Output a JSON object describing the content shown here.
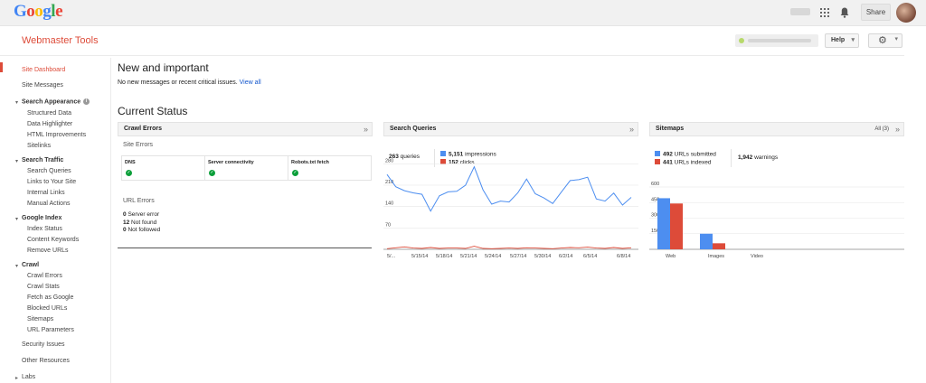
{
  "header": {
    "logo_letters": [
      {
        "ch": "G",
        "color": "#4285f4"
      },
      {
        "ch": "o",
        "color": "#ea4335"
      },
      {
        "ch": "o",
        "color": "#fbbc05"
      },
      {
        "ch": "g",
        "color": "#4285f4"
      },
      {
        "ch": "l",
        "color": "#34a853"
      },
      {
        "ch": "e",
        "color": "#ea4335"
      }
    ],
    "share_label": "Share"
  },
  "product": {
    "title": "Webmaster Tools",
    "help_label": "Help"
  },
  "sidebar": {
    "items": [
      {
        "label": "Site Dashboard",
        "kind": "item",
        "active": true
      },
      {
        "label": "Site Messages",
        "kind": "item"
      },
      {
        "label": "Search Appearance",
        "kind": "section",
        "info": true
      },
      {
        "label": "Structured Data",
        "kind": "sub"
      },
      {
        "label": "Data Highlighter",
        "kind": "sub"
      },
      {
        "label": "HTML Improvements",
        "kind": "sub"
      },
      {
        "label": "Sitelinks",
        "kind": "sub"
      },
      {
        "label": "Search Traffic",
        "kind": "section"
      },
      {
        "label": "Search Queries",
        "kind": "sub"
      },
      {
        "label": "Links to Your Site",
        "kind": "sub"
      },
      {
        "label": "Internal Links",
        "kind": "sub"
      },
      {
        "label": "Manual Actions",
        "kind": "sub"
      },
      {
        "label": "Google Index",
        "kind": "section"
      },
      {
        "label": "Index Status",
        "kind": "sub"
      },
      {
        "label": "Content Keywords",
        "kind": "sub"
      },
      {
        "label": "Remove URLs",
        "kind": "sub"
      },
      {
        "label": "Crawl",
        "kind": "section"
      },
      {
        "label": "Crawl Errors",
        "kind": "sub"
      },
      {
        "label": "Crawl Stats",
        "kind": "sub"
      },
      {
        "label": "Fetch as Google",
        "kind": "sub"
      },
      {
        "label": "Blocked URLs",
        "kind": "sub"
      },
      {
        "label": "Sitemaps",
        "kind": "sub"
      },
      {
        "label": "URL Parameters",
        "kind": "sub"
      },
      {
        "label": "Security Issues",
        "kind": "item"
      },
      {
        "label": "Other Resources",
        "kind": "item"
      },
      {
        "label": "Labs",
        "kind": "collapsed"
      }
    ]
  },
  "main": {
    "new_title": "New and important",
    "new_message": "No new messages or recent critical issues.",
    "view_all": "View all",
    "status_title": "Current Status"
  },
  "crawl_errors": {
    "title": "Crawl Errors",
    "site_errors_label": "Site Errors",
    "columns": [
      "DNS",
      "Server connectivity",
      "Robots.txt fetch"
    ],
    "url_errors_label": "URL Errors",
    "stats": [
      {
        "value": "0",
        "label": "Server error"
      },
      {
        "value": "12",
        "label": "Not found"
      },
      {
        "value": "0",
        "label": "Not followed"
      }
    ]
  },
  "search_queries": {
    "title": "Search Queries",
    "queries_value": "263",
    "queries_label": "queries",
    "impressions_value": "5,151",
    "impressions_label": "impressions",
    "clicks_value": "152",
    "clicks_label": "clicks"
  },
  "sitemaps": {
    "title": "Sitemaps",
    "all_label": "All (3)",
    "submitted_value": "492",
    "submitted_label": "URLs submitted",
    "indexed_value": "441",
    "indexed_label": "URLs indexed",
    "warnings_value": "1,942",
    "warnings_label": "warnings"
  },
  "colors": {
    "blue": "#4d8ef0",
    "red": "#dd4b39",
    "accent": "#dd4b39",
    "link": "#1155cc"
  },
  "chart_data": [
    {
      "type": "line",
      "yticks": [
        280,
        210,
        140,
        70
      ],
      "ylim": [
        0,
        300
      ],
      "x_tick_labels": [
        "5/...",
        "5/15/14",
        "5/18/14",
        "5/21/14",
        "5/24/14",
        "5/27/14",
        "5/30/14",
        "6/2/14",
        "6/5/14",
        "6/8/14"
      ],
      "series": [
        {
          "name": "impressions",
          "color": "#4d8ef0",
          "values": [
            245,
            205,
            192,
            185,
            180,
            125,
            175,
            188,
            190,
            210,
            270,
            195,
            148,
            158,
            155,
            185,
            230,
            182,
            168,
            150,
            188,
            225,
            228,
            236,
            165,
            158,
            184,
            145,
            170
          ]
        },
        {
          "name": "clicks",
          "color": "#dd4b39",
          "values": [
            2,
            5,
            8,
            4,
            3,
            6,
            3,
            4,
            4,
            3,
            10,
            3,
            2,
            3,
            4,
            3,
            5,
            4,
            3,
            2,
            4,
            6,
            5,
            7,
            4,
            3,
            6,
            3,
            5
          ]
        }
      ]
    },
    {
      "type": "bar",
      "categories": [
        "Web",
        "Images",
        "Video"
      ],
      "yticks": [
        600,
        450,
        300,
        150
      ],
      "ylim": [
        0,
        600
      ],
      "series": [
        {
          "name": "URLs submitted",
          "color": "#4d8ef0",
          "values": [
            492,
            150,
            0
          ]
        },
        {
          "name": "URLs indexed",
          "color": "#dd4b39",
          "values": [
            441,
            58,
            0
          ]
        }
      ]
    }
  ]
}
